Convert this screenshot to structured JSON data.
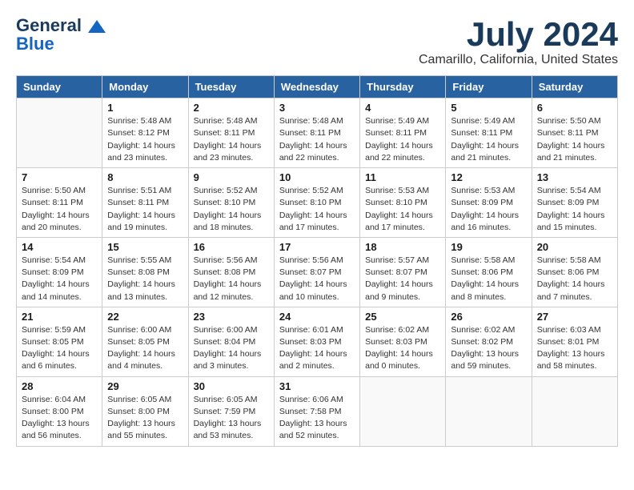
{
  "header": {
    "logo_line1": "General",
    "logo_line2": "Blue",
    "title": "July 2024",
    "subtitle": "Camarillo, California, United States"
  },
  "days_of_week": [
    "Sunday",
    "Monday",
    "Tuesday",
    "Wednesday",
    "Thursday",
    "Friday",
    "Saturday"
  ],
  "weeks": [
    [
      {
        "day": "",
        "info": ""
      },
      {
        "day": "1",
        "info": "Sunrise: 5:48 AM\nSunset: 8:12 PM\nDaylight: 14 hours\nand 23 minutes."
      },
      {
        "day": "2",
        "info": "Sunrise: 5:48 AM\nSunset: 8:11 PM\nDaylight: 14 hours\nand 23 minutes."
      },
      {
        "day": "3",
        "info": "Sunrise: 5:48 AM\nSunset: 8:11 PM\nDaylight: 14 hours\nand 22 minutes."
      },
      {
        "day": "4",
        "info": "Sunrise: 5:49 AM\nSunset: 8:11 PM\nDaylight: 14 hours\nand 22 minutes."
      },
      {
        "day": "5",
        "info": "Sunrise: 5:49 AM\nSunset: 8:11 PM\nDaylight: 14 hours\nand 21 minutes."
      },
      {
        "day": "6",
        "info": "Sunrise: 5:50 AM\nSunset: 8:11 PM\nDaylight: 14 hours\nand 21 minutes."
      }
    ],
    [
      {
        "day": "7",
        "info": "Sunrise: 5:50 AM\nSunset: 8:11 PM\nDaylight: 14 hours\nand 20 minutes."
      },
      {
        "day": "8",
        "info": "Sunrise: 5:51 AM\nSunset: 8:11 PM\nDaylight: 14 hours\nand 19 minutes."
      },
      {
        "day": "9",
        "info": "Sunrise: 5:52 AM\nSunset: 8:10 PM\nDaylight: 14 hours\nand 18 minutes."
      },
      {
        "day": "10",
        "info": "Sunrise: 5:52 AM\nSunset: 8:10 PM\nDaylight: 14 hours\nand 17 minutes."
      },
      {
        "day": "11",
        "info": "Sunrise: 5:53 AM\nSunset: 8:10 PM\nDaylight: 14 hours\nand 17 minutes."
      },
      {
        "day": "12",
        "info": "Sunrise: 5:53 AM\nSunset: 8:09 PM\nDaylight: 14 hours\nand 16 minutes."
      },
      {
        "day": "13",
        "info": "Sunrise: 5:54 AM\nSunset: 8:09 PM\nDaylight: 14 hours\nand 15 minutes."
      }
    ],
    [
      {
        "day": "14",
        "info": "Sunrise: 5:54 AM\nSunset: 8:09 PM\nDaylight: 14 hours\nand 14 minutes."
      },
      {
        "day": "15",
        "info": "Sunrise: 5:55 AM\nSunset: 8:08 PM\nDaylight: 14 hours\nand 13 minutes."
      },
      {
        "day": "16",
        "info": "Sunrise: 5:56 AM\nSunset: 8:08 PM\nDaylight: 14 hours\nand 12 minutes."
      },
      {
        "day": "17",
        "info": "Sunrise: 5:56 AM\nSunset: 8:07 PM\nDaylight: 14 hours\nand 10 minutes."
      },
      {
        "day": "18",
        "info": "Sunrise: 5:57 AM\nSunset: 8:07 PM\nDaylight: 14 hours\nand 9 minutes."
      },
      {
        "day": "19",
        "info": "Sunrise: 5:58 AM\nSunset: 8:06 PM\nDaylight: 14 hours\nand 8 minutes."
      },
      {
        "day": "20",
        "info": "Sunrise: 5:58 AM\nSunset: 8:06 PM\nDaylight: 14 hours\nand 7 minutes."
      }
    ],
    [
      {
        "day": "21",
        "info": "Sunrise: 5:59 AM\nSunset: 8:05 PM\nDaylight: 14 hours\nand 6 minutes."
      },
      {
        "day": "22",
        "info": "Sunrise: 6:00 AM\nSunset: 8:05 PM\nDaylight: 14 hours\nand 4 minutes."
      },
      {
        "day": "23",
        "info": "Sunrise: 6:00 AM\nSunset: 8:04 PM\nDaylight: 14 hours\nand 3 minutes."
      },
      {
        "day": "24",
        "info": "Sunrise: 6:01 AM\nSunset: 8:03 PM\nDaylight: 14 hours\nand 2 minutes."
      },
      {
        "day": "25",
        "info": "Sunrise: 6:02 AM\nSunset: 8:03 PM\nDaylight: 14 hours\nand 0 minutes."
      },
      {
        "day": "26",
        "info": "Sunrise: 6:02 AM\nSunset: 8:02 PM\nDaylight: 13 hours\nand 59 minutes."
      },
      {
        "day": "27",
        "info": "Sunrise: 6:03 AM\nSunset: 8:01 PM\nDaylight: 13 hours\nand 58 minutes."
      }
    ],
    [
      {
        "day": "28",
        "info": "Sunrise: 6:04 AM\nSunset: 8:00 PM\nDaylight: 13 hours\nand 56 minutes."
      },
      {
        "day": "29",
        "info": "Sunrise: 6:05 AM\nSunset: 8:00 PM\nDaylight: 13 hours\nand 55 minutes."
      },
      {
        "day": "30",
        "info": "Sunrise: 6:05 AM\nSunset: 7:59 PM\nDaylight: 13 hours\nand 53 minutes."
      },
      {
        "day": "31",
        "info": "Sunrise: 6:06 AM\nSunset: 7:58 PM\nDaylight: 13 hours\nand 52 minutes."
      },
      {
        "day": "",
        "info": ""
      },
      {
        "day": "",
        "info": ""
      },
      {
        "day": "",
        "info": ""
      }
    ]
  ]
}
